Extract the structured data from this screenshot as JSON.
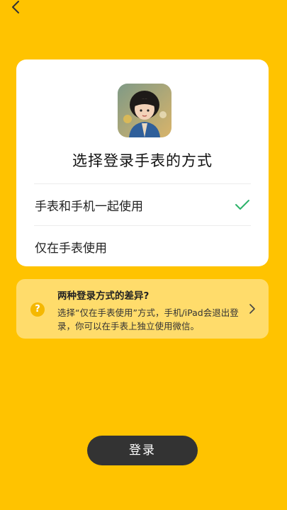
{
  "header": {
    "back_icon": "chevron-left-icon"
  },
  "card": {
    "avatar_icon": "child-photo-avatar",
    "title": "选择登录手表的方式",
    "options": [
      {
        "label": "手表和手机一起使用",
        "selected": true
      },
      {
        "label": "仅在手表使用",
        "selected": false
      }
    ],
    "check_color": "#2DB36A"
  },
  "info": {
    "icon": "question-icon",
    "title": "两种登录方式的差异?",
    "description": "选择“仅在手表使用”方式，手机/iPad会退出登录，你可以在手表上独立使用微信。"
  },
  "login_button": {
    "label": "登录"
  },
  "colors": {
    "background": "#FFC300",
    "button": "#333333"
  }
}
